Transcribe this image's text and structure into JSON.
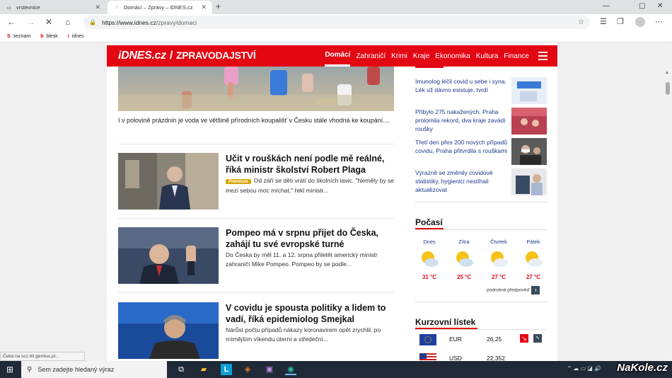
{
  "browser": {
    "tabs": [
      {
        "title": "vrstevnice"
      },
      {
        "title": "Domácí – Zprávy – iDNES.cz"
      }
    ],
    "url_host": "https://www.idnes.cz",
    "url_path": "/zpravy/domaci",
    "bookmarks": [
      {
        "label": "seznam",
        "icon": "S"
      },
      {
        "label": "blesk",
        "icon": "b"
      },
      {
        "label": "idnes",
        "icon": "i"
      }
    ],
    "status_text": "Čeká na scz.hit.gemius.pl..."
  },
  "site": {
    "logo": "iDNES.cz",
    "section": "ZPRAVODAJSTVÍ",
    "menu": [
      "Domácí",
      "Zahraničí",
      "Krimi",
      "Kraje",
      "Ekonomika",
      "Kultura",
      "Finance"
    ],
    "active_menu": "Domácí"
  },
  "hero_caption": "I v polovině prázdnin je voda ve většině přírodních koupališť v Česku stále vhodná ke koupání....",
  "articles": [
    {
      "title": "Učit v rouškách není podle mě reálné, říká ministr školství Robert Plaga",
      "badge": "Premium",
      "perex": "Od září se děti vrátí do školních lavic. \"Neměly by se mezi sebou moc míchat,\" řekl ministr..."
    },
    {
      "title": "Pompeo má v srpnu přijet do Česka, zahájí tu své evropské turné",
      "badge": "",
      "perex": "Do Česka by měl 11. a 12. srpna přiletět americký ministr zahraničí Mike Pompeo. Pompeo by se podle..."
    },
    {
      "title": "V covidu je spousta politiky a lidem to vadí, říká epidemiolog Smejkal",
      "badge": "",
      "perex": "Nárůst počtu případů nákazy koronavirem opět zrychlil, po mírnějším víkendu úterní a středeční..."
    }
  ],
  "side_news": [
    "Imunolog léčil covid u sebe i syna. Lék už dávno existuje, tvrdí",
    "Přibylo 275 nakažených. Praha prolomila rekord, dva kraje zavádí roušky",
    "Třetí den přes 200 nových případů covidu, Praha přitvrdila s rouškami",
    "Výrazně se změnily covidové statistiky, hygienici nestíhali aktualizovat"
  ],
  "weather": {
    "title": "Počasí",
    "days": [
      {
        "day": "Dnes",
        "temp": "31 °C"
      },
      {
        "day": "Zítra",
        "temp": "25 °C"
      },
      {
        "day": "Čtvrtek",
        "temp": "27 °C"
      },
      {
        "day": "Pátek",
        "temp": "27 °C"
      }
    ],
    "more": "podrobná předpověď"
  },
  "currency": {
    "title": "Kurzovní lístek",
    "rows": [
      {
        "code": "EUR",
        "value": "26,25"
      },
      {
        "code": "USD",
        "value": "22,352"
      }
    ]
  },
  "taskbar": {
    "search_placeholder": "Sem zadejte hledaný výraz"
  },
  "watermark": "NaKole.cz"
}
